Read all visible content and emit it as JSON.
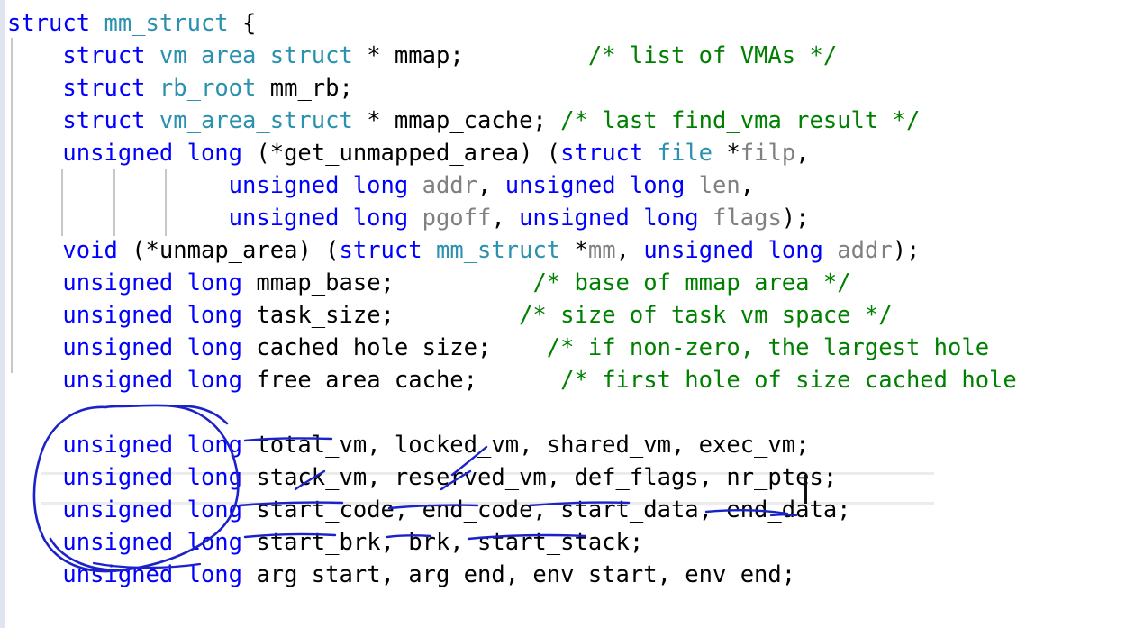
{
  "editor": {
    "language": "C",
    "background_color": "#ffffff",
    "edge_strip_color": "#dfe5ef",
    "current_line_rule_color": "#ececec",
    "indent_guide_color": "#c8c8c8",
    "caret_color": "#101010",
    "annotation_ink_color": "#1b22c8"
  },
  "syntax_colors": {
    "keyword": "#0000ff",
    "type": "#2b91af",
    "identifier": "#000000",
    "parameter": "#808080",
    "comment": "#008000",
    "punctuation": "#000000"
  },
  "code": {
    "lines": [
      {
        "n": 1,
        "text": "struct mm_struct {",
        "tokens": [
          {
            "t": "struct",
            "c": "kw"
          },
          {
            "t": " ",
            "c": "pun"
          },
          {
            "t": "mm_struct",
            "c": "typ"
          },
          {
            "t": " {",
            "c": "pun"
          }
        ]
      },
      {
        "n": 2,
        "text": "    struct vm_area_struct * mmap;            /* list of VMAs */",
        "tokens": [
          {
            "t": "    ",
            "c": "pun"
          },
          {
            "t": "struct",
            "c": "kw"
          },
          {
            "t": " ",
            "c": "pun"
          },
          {
            "t": "vm_area_struct",
            "c": "typ"
          },
          {
            "t": " * ",
            "c": "pun"
          },
          {
            "t": "mmap;",
            "c": "id"
          },
          {
            "t": "         ",
            "c": "pun"
          },
          {
            "t": "/* list of VMAs */",
            "c": "cmt"
          }
        ]
      },
      {
        "n": 3,
        "text": "    struct rb_root mm_rb;",
        "tokens": [
          {
            "t": "    ",
            "c": "pun"
          },
          {
            "t": "struct",
            "c": "kw"
          },
          {
            "t": " ",
            "c": "pun"
          },
          {
            "t": "rb_root",
            "c": "typ"
          },
          {
            "t": " ",
            "c": "pun"
          },
          {
            "t": "mm_rb;",
            "c": "id"
          }
        ]
      },
      {
        "n": 4,
        "text": "    struct vm_area_struct * mmap_cache; /* last find_vma result */",
        "tokens": [
          {
            "t": "    ",
            "c": "pun"
          },
          {
            "t": "struct",
            "c": "kw"
          },
          {
            "t": " ",
            "c": "pun"
          },
          {
            "t": "vm_area_struct",
            "c": "typ"
          },
          {
            "t": " * ",
            "c": "pun"
          },
          {
            "t": "mmap_cache;",
            "c": "id"
          },
          {
            "t": " ",
            "c": "pun"
          },
          {
            "t": "/* last find_vma result */",
            "c": "cmt"
          }
        ]
      },
      {
        "n": 5,
        "text": "    unsigned long (*get_unmapped_area) (struct file *filp,",
        "tokens": [
          {
            "t": "    ",
            "c": "pun"
          },
          {
            "t": "unsigned long",
            "c": "kw"
          },
          {
            "t": " (*",
            "c": "pun"
          },
          {
            "t": "get_unmapped_area",
            "c": "id"
          },
          {
            "t": ") (",
            "c": "pun"
          },
          {
            "t": "struct",
            "c": "kw"
          },
          {
            "t": " ",
            "c": "pun"
          },
          {
            "t": "file",
            "c": "typ"
          },
          {
            "t": " *",
            "c": "pun"
          },
          {
            "t": "filp",
            "c": "dim"
          },
          {
            "t": ",",
            "c": "pun"
          }
        ]
      },
      {
        "n": 6,
        "text": "                unsigned long addr, unsigned long len,",
        "tokens": [
          {
            "t": "                ",
            "c": "pun"
          },
          {
            "t": "unsigned long",
            "c": "kw"
          },
          {
            "t": " ",
            "c": "pun"
          },
          {
            "t": "addr",
            "c": "dim"
          },
          {
            "t": ", ",
            "c": "pun"
          },
          {
            "t": "unsigned long",
            "c": "kw"
          },
          {
            "t": " ",
            "c": "pun"
          },
          {
            "t": "len",
            "c": "dim"
          },
          {
            "t": ",",
            "c": "pun"
          }
        ]
      },
      {
        "n": 7,
        "text": "                unsigned long pgoff, unsigned long flags);",
        "tokens": [
          {
            "t": "                ",
            "c": "pun"
          },
          {
            "t": "unsigned long",
            "c": "kw"
          },
          {
            "t": " ",
            "c": "pun"
          },
          {
            "t": "pgoff",
            "c": "dim"
          },
          {
            "t": ", ",
            "c": "pun"
          },
          {
            "t": "unsigned long",
            "c": "kw"
          },
          {
            "t": " ",
            "c": "pun"
          },
          {
            "t": "flags",
            "c": "dim"
          },
          {
            "t": ");",
            "c": "pun"
          }
        ]
      },
      {
        "n": 8,
        "text": "    void (*unmap_area) (struct mm_struct *mm, unsigned long addr);",
        "tokens": [
          {
            "t": "    ",
            "c": "pun"
          },
          {
            "t": "void",
            "c": "kw"
          },
          {
            "t": " (*",
            "c": "pun"
          },
          {
            "t": "unmap_area",
            "c": "id"
          },
          {
            "t": ") (",
            "c": "pun"
          },
          {
            "t": "struct",
            "c": "kw"
          },
          {
            "t": " ",
            "c": "pun"
          },
          {
            "t": "mm_struct",
            "c": "typ"
          },
          {
            "t": " *",
            "c": "pun"
          },
          {
            "t": "mm",
            "c": "dim"
          },
          {
            "t": ", ",
            "c": "pun"
          },
          {
            "t": "unsigned long",
            "c": "kw"
          },
          {
            "t": " ",
            "c": "pun"
          },
          {
            "t": "addr",
            "c": "dim"
          },
          {
            "t": ");",
            "c": "pun"
          }
        ]
      },
      {
        "n": 9,
        "text": "    unsigned long mmap_base;          /* base of mmap area */",
        "tokens": [
          {
            "t": "    ",
            "c": "pun"
          },
          {
            "t": "unsigned long",
            "c": "kw"
          },
          {
            "t": " ",
            "c": "pun"
          },
          {
            "t": "mmap_base;",
            "c": "id"
          },
          {
            "t": "          ",
            "c": "pun"
          },
          {
            "t": "/* base of mmap area */",
            "c": "cmt"
          }
        ]
      },
      {
        "n": 10,
        "text": "    unsigned long task_size;         /* size of task vm space */",
        "tokens": [
          {
            "t": "    ",
            "c": "pun"
          },
          {
            "t": "unsigned long",
            "c": "kw"
          },
          {
            "t": " ",
            "c": "pun"
          },
          {
            "t": "task_size;",
            "c": "id"
          },
          {
            "t": "         ",
            "c": "pun"
          },
          {
            "t": "/* size of task vm space */",
            "c": "cmt"
          }
        ]
      },
      {
        "n": 11,
        "text": "    unsigned long cached_hole_size;     /* if non-zero, the largest hole",
        "tokens": [
          {
            "t": "    ",
            "c": "pun"
          },
          {
            "t": "unsigned long",
            "c": "kw"
          },
          {
            "t": " ",
            "c": "pun"
          },
          {
            "t": "cached_hole_size;",
            "c": "id"
          },
          {
            "t": "    ",
            "c": "pun"
          },
          {
            "t": "/* if non-zero, the largest hole",
            "c": "cmt"
          }
        ]
      },
      {
        "n": 12,
        "text": "    unsigned long free area cache;       /* first hole of size cached hole",
        "tokens": [
          {
            "t": "    ",
            "c": "pun"
          },
          {
            "t": "unsigned long",
            "c": "kw"
          },
          {
            "t": " ",
            "c": "pun"
          },
          {
            "t": "free area cache;",
            "c": "id"
          },
          {
            "t": "      ",
            "c": "pun"
          },
          {
            "t": "/* first hole of size cached hole",
            "c": "cmt"
          }
        ]
      },
      {
        "n": 13,
        "text": "",
        "tokens": []
      },
      {
        "n": 14,
        "text": "    unsigned long total_vm, locked_vm, shared_vm, exec_vm;",
        "tokens": [
          {
            "t": "    ",
            "c": "pun"
          },
          {
            "t": "unsigned long",
            "c": "kw"
          },
          {
            "t": " ",
            "c": "pun"
          },
          {
            "t": "total_vm, locked_vm, shared_vm, exec_vm;",
            "c": "id"
          }
        ]
      },
      {
        "n": 15,
        "text": "    unsigned long stack_vm, reserved_vm, def_flags, nr_ptes;",
        "tokens": [
          {
            "t": "    ",
            "c": "pun"
          },
          {
            "t": "unsigned long",
            "c": "kw"
          },
          {
            "t": " ",
            "c": "pun"
          },
          {
            "t": "stack_vm, reserved_vm, def_flags, nr_ptes;",
            "c": "id"
          }
        ]
      },
      {
        "n": 16,
        "text": "    unsigned long start_code, end_code, start_data, end_data;",
        "tokens": [
          {
            "t": "    ",
            "c": "pun"
          },
          {
            "t": "unsigned long",
            "c": "kw"
          },
          {
            "t": " ",
            "c": "pun"
          },
          {
            "t": "start_code, end_code, start_data, end_data;",
            "c": "id"
          }
        ]
      },
      {
        "n": 17,
        "text": "    unsigned long start_brk, brk, start_stack;",
        "tokens": [
          {
            "t": "    ",
            "c": "pun"
          },
          {
            "t": "unsigned long",
            "c": "kw"
          },
          {
            "t": " ",
            "c": "pun"
          },
          {
            "t": "start_brk, brk, start_stack;",
            "c": "id"
          }
        ]
      },
      {
        "n": 18,
        "text": "    unsigned long arg_start, arg_end, env_start, env_end;",
        "tokens": [
          {
            "t": "    ",
            "c": "pun"
          },
          {
            "t": "unsigned long",
            "c": "kw"
          },
          {
            "t": " ",
            "c": "pun"
          },
          {
            "t": "arg_start, arg_end, env_start, env_end;",
            "c": "id"
          }
        ]
      }
    ]
  },
  "current_line": {
    "line_number": 16,
    "caret_after_text": "end_data;"
  },
  "annotations": {
    "ink_color": "#1b22c8",
    "circle_label": "hand-drawn oval around the repeated 'unsigned long' type declarations on lines 14-18",
    "underline_labels": [
      "total_vm",
      "stack_vm",
      "start_code",
      "end_code",
      "start_data",
      "end_data",
      "start_brk",
      "brk",
      "start_stack"
    ],
    "tick_labels": [
      "start_code",
      "end_code"
    ]
  }
}
